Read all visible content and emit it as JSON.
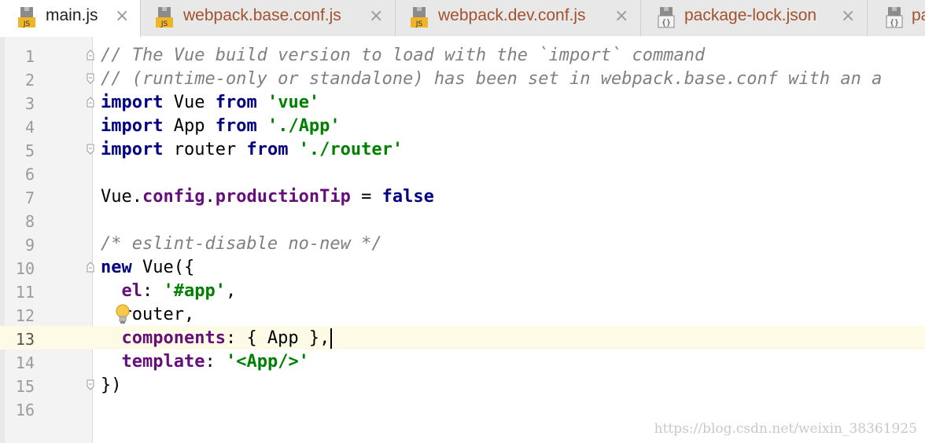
{
  "tabs": [
    {
      "label": "main.js",
      "icon": "js-file-icon",
      "active": true,
      "close": "×"
    },
    {
      "label": "webpack.base.conf.js",
      "icon": "js-file-icon",
      "active": false,
      "close": "×"
    },
    {
      "label": "webpack.dev.conf.js",
      "icon": "js-file-icon",
      "active": false,
      "close": "×"
    },
    {
      "label": "package-lock.json",
      "icon": "json-file-icon",
      "active": false,
      "close": "×"
    },
    {
      "label": "pa",
      "icon": "json-file-icon",
      "active": false,
      "close": ""
    }
  ],
  "icon_text": {
    "js": "JS",
    "json": "{}"
  },
  "lines": [
    {
      "num": "1",
      "text": "// The Vue build version to load with the `import` command"
    },
    {
      "num": "2",
      "text": "// (runtime-only or standalone) has been set in webpack.base.conf with an a"
    },
    {
      "num": "3",
      "text": "import Vue from 'vue'"
    },
    {
      "num": "4",
      "text": "import App from './App'"
    },
    {
      "num": "5",
      "text": "import router from './router'"
    },
    {
      "num": "6",
      "text": ""
    },
    {
      "num": "7",
      "text": "Vue.config.productionTip = false"
    },
    {
      "num": "8",
      "text": ""
    },
    {
      "num": "9",
      "text": "/* eslint-disable no-new */"
    },
    {
      "num": "10",
      "text": "new Vue({"
    },
    {
      "num": "11",
      "text": "  el: '#app',"
    },
    {
      "num": "12",
      "text": "  router,"
    },
    {
      "num": "13",
      "text": "  components: { App },"
    },
    {
      "num": "14",
      "text": "  template: '<App/>'"
    },
    {
      "num": "15",
      "text": "})"
    },
    {
      "num": "16",
      "text": ""
    }
  ],
  "current_line": "13",
  "watermark": "https://blog.csdn.net/weixin_38361925",
  "colors": {
    "keyword": "#000080",
    "string": "#008000",
    "comment": "#808080",
    "property": "#660e7a",
    "current_line_bg": "#fdfbe6",
    "tab_active_bg": "#ffffff",
    "tab_inactive_bg": "#e8e8e8"
  }
}
